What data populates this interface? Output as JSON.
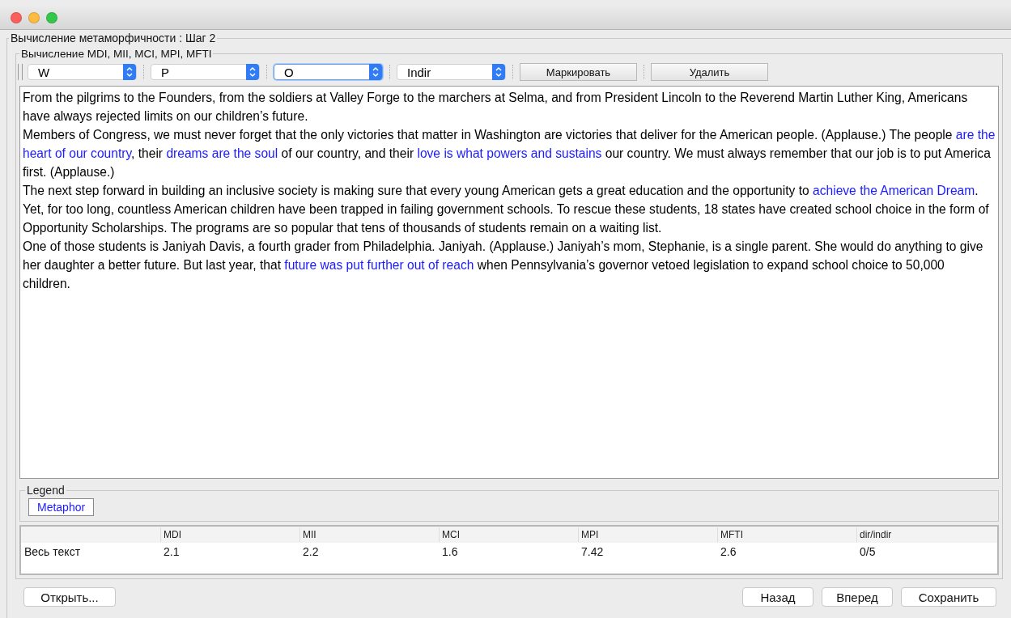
{
  "window": {
    "title": "Вычисление метаморфичности : Шаг 2"
  },
  "panel": {
    "title": "Вычисление MDI, MII, MCI, MPI, MFTI"
  },
  "toolbar": {
    "combos": [
      {
        "value": "W",
        "focused": false
      },
      {
        "value": "P",
        "focused": false
      },
      {
        "value": "O",
        "focused": true
      },
      {
        "value": "Indir",
        "focused": false
      }
    ],
    "buttons": [
      "Маркировать",
      "Удалить"
    ]
  },
  "text": {
    "paragraphs": [
      [
        {
          "kind": "plain",
          "text": "From the pilgrims to the Founders, from the soldiers at Valley Forge to the marchers at Selma, and from President Lincoln to the Reverend Martin Luther King, Americans have always rejected limits on our children’s future."
        }
      ],
      [
        {
          "kind": "plain",
          "text": "Members of Congress, we must never forget that the only victories that matter in Washington are victories that deliver for the American people.  (Applause.)  The people "
        },
        {
          "kind": "metaphor",
          "text": "are the heart of our country"
        },
        {
          "kind": "plain",
          "text": ", their "
        },
        {
          "kind": "metaphor",
          "text": "dreams are the soul"
        },
        {
          "kind": "plain",
          "text": " of our country, and their "
        },
        {
          "kind": "metaphor",
          "text": "love is what powers and sustains"
        },
        {
          "kind": "plain",
          "text": " our country.  We must always remember that our job is to put America first.  (Applause.)"
        }
      ],
      [
        {
          "kind": "plain",
          "text": "The next step forward in building an inclusive society is making sure that every young American gets a great education and the opportunity to "
        },
        {
          "kind": "metaphor",
          "text": "achieve the American Dream"
        },
        {
          "kind": "plain",
          "text": ".  Yet, for too long, countless American children have been trapped in failing government schools.  To rescue these students, 18 states have created school choice in the form of Opportunity Scholarships.  The programs are so popular that tens of thousands of students remain on a waiting list."
        }
      ],
      [
        {
          "kind": "plain",
          "text": "One of those students is Janiyah Davis, a fourth grader from Philadelphia.  Janiyah.  (Applause.)  Janiyah’s mom, Stephanie, is a single parent.  She would do anything to give her daughter a better future.  But last year, that "
        },
        {
          "kind": "metaphor",
          "text": "future was put further out of reach"
        },
        {
          "kind": "plain",
          "text": " when Pennsylvania’s governor vetoed legislation to expand school choice to 50,000 children."
        }
      ]
    ]
  },
  "legend": {
    "title": "Legend",
    "items": [
      {
        "label": "Metaphor",
        "color": "#1a1aff"
      }
    ]
  },
  "table": {
    "columns": [
      "",
      "MDI",
      "MII",
      "MCI",
      "MPI",
      "MFTI",
      "dir/indir"
    ],
    "rows": [
      [
        "Весь текст",
        "2.1",
        "2.2",
        "1.6",
        "7.42",
        "2.6",
        "0/5"
      ]
    ]
  },
  "footer": {
    "left_buttons": [
      "Открыть..."
    ],
    "right_buttons": [
      "Назад",
      "Вперед",
      "Сохранить"
    ]
  }
}
